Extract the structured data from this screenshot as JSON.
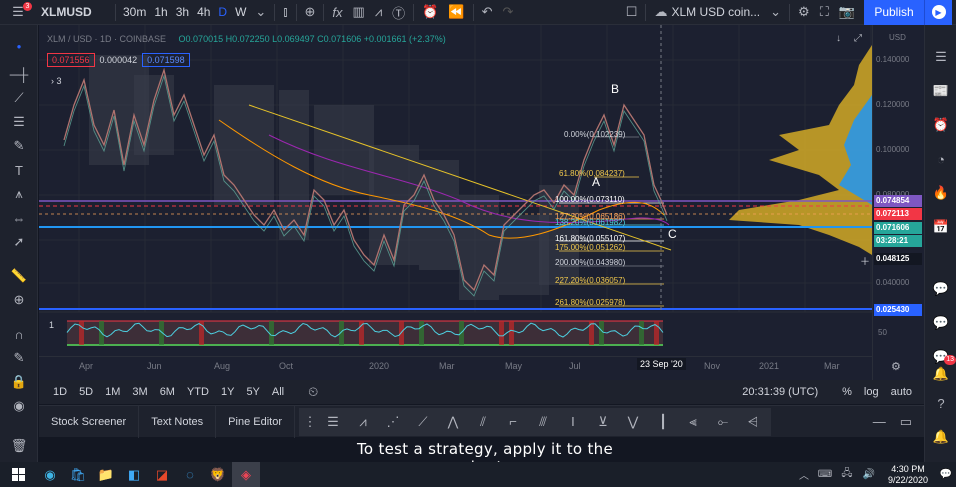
{
  "topbar": {
    "symbol": "XLMUSD",
    "intervals": [
      "30m",
      "1h",
      "3h",
      "4h",
      "D",
      "W"
    ],
    "active_interval": "D",
    "layout_name": "XLM USD coin...",
    "publish_label": "Publish"
  },
  "legend": {
    "title": "XLM / USD · 1D · COINBASE",
    "ohlc": "O0.070015  H0.072250  L0.069497  C0.071606  +0.001661 (+2.37%)",
    "bid": "0.071556",
    "spread": "0.000042",
    "ask": "0.071598",
    "indicator_count": "3"
  },
  "price_axis": {
    "unit": "USD",
    "ticks": [
      "0.140000",
      "0.120000",
      "0.100000",
      "0.080000",
      "0.060000",
      "0.040000"
    ],
    "tags": [
      {
        "text": "0.074854",
        "color": "#7e57c2"
      },
      {
        "text": "0.072113",
        "color": "#f23645"
      },
      {
        "text": "0.071606",
        "color": "#26a69a"
      },
      {
        "text": "03:28:21",
        "color": "#26a69a"
      },
      {
        "text": "0.048125",
        "color": "#131722"
      },
      {
        "text": "0.025430",
        "color": "#2962ff"
      }
    ]
  },
  "time_axis": {
    "ticks": [
      "Apr",
      "Jun",
      "Aug",
      "Oct",
      "2020",
      "Mar",
      "May",
      "Jul",
      "Nov",
      "2021",
      "Mar"
    ],
    "crosshair_label": "23 Sep '20"
  },
  "fib_levels": [
    {
      "label": "0.00%(0.102239)",
      "color": "#d1d4dc"
    },
    {
      "label": "61.80%(0.084237)",
      "color": "#f2c94c"
    },
    {
      "label": "100.00%(0.073110)",
      "color": "#ffffff"
    },
    {
      "label": "127.20%(0.065186)",
      "color": "#f7a35c"
    },
    {
      "label": "138.20%(0.061982)",
      "color": "#4dd0e1"
    },
    {
      "label": "161.80%(0.055107)",
      "color": "#ffffff"
    },
    {
      "label": "175.00%(0.051262)",
      "color": "#f2c94c"
    },
    {
      "label": "200.00%(0.043980)",
      "color": "#d1d4dc"
    },
    {
      "label": "227.20%(0.036057)",
      "color": "#f2c94c"
    },
    {
      "label": "261.80%(0.025978)",
      "color": "#f2c94c"
    }
  ],
  "wave_labels": [
    "A",
    "B",
    "C"
  ],
  "oscillator": {
    "pane_index": "1",
    "level_label": "50"
  },
  "range_bar": {
    "buttons": [
      "1D",
      "5D",
      "1M",
      "3M",
      "6M",
      "YTD",
      "1Y",
      "5Y",
      "All"
    ],
    "clock": "20:31:39 (UTC)",
    "percent": "%",
    "log": "log",
    "auto": "auto"
  },
  "bottom_tabs": [
    "Stock Screener",
    "Text Notes",
    "Pine Editor"
  ],
  "subtitle": "To test a strategy, apply it to the chart.",
  "taskbar": {
    "time": "4:30 PM",
    "date": "9/22/2020"
  },
  "notifications": {
    "menu_badge": "3",
    "alerts_badge": "13"
  }
}
